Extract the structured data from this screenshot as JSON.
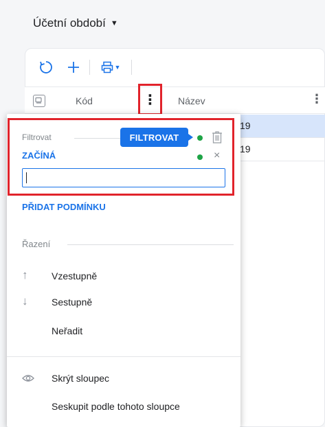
{
  "page": {
    "title": "Účetní období"
  },
  "toolbar": {
    "refresh_icon": "refresh-icon",
    "add_icon": "plus-icon",
    "print_icon": "print-icon"
  },
  "grid": {
    "columns": [
      {
        "label": "Kód"
      },
      {
        "label": "Název"
      }
    ],
    "rows": [
      {
        "text": "19",
        "selected": true
      },
      {
        "text": "19",
        "selected": false
      }
    ]
  },
  "column_menu": {
    "filter": {
      "section_label": "Filtrovat",
      "apply_button": "FILTROVAT",
      "operator": "ZAČÍNÁ",
      "clear_glyph": "×",
      "input_value": "",
      "add_condition": "PŘIDAT PODMÍNKU"
    },
    "sort": {
      "section_label": "Řazení",
      "items": [
        {
          "label": "Vzestupně",
          "icon": "arrow-up-icon",
          "glyph": "↑"
        },
        {
          "label": "Sestupně",
          "icon": "arrow-down-icon",
          "glyph": "↓"
        },
        {
          "label": "Neřadit",
          "icon": "",
          "glyph": ""
        }
      ]
    },
    "column": {
      "items": [
        {
          "label": "Skrýt sloupec",
          "icon": "eye-icon"
        },
        {
          "label": "Seskupit podle tohoto sloupce",
          "icon": ""
        }
      ]
    }
  },
  "colors": {
    "accent": "#1a73e8",
    "highlight_border": "#e1232b",
    "status_dot": "#1ea446",
    "selected_row": "#d7e5fb"
  }
}
